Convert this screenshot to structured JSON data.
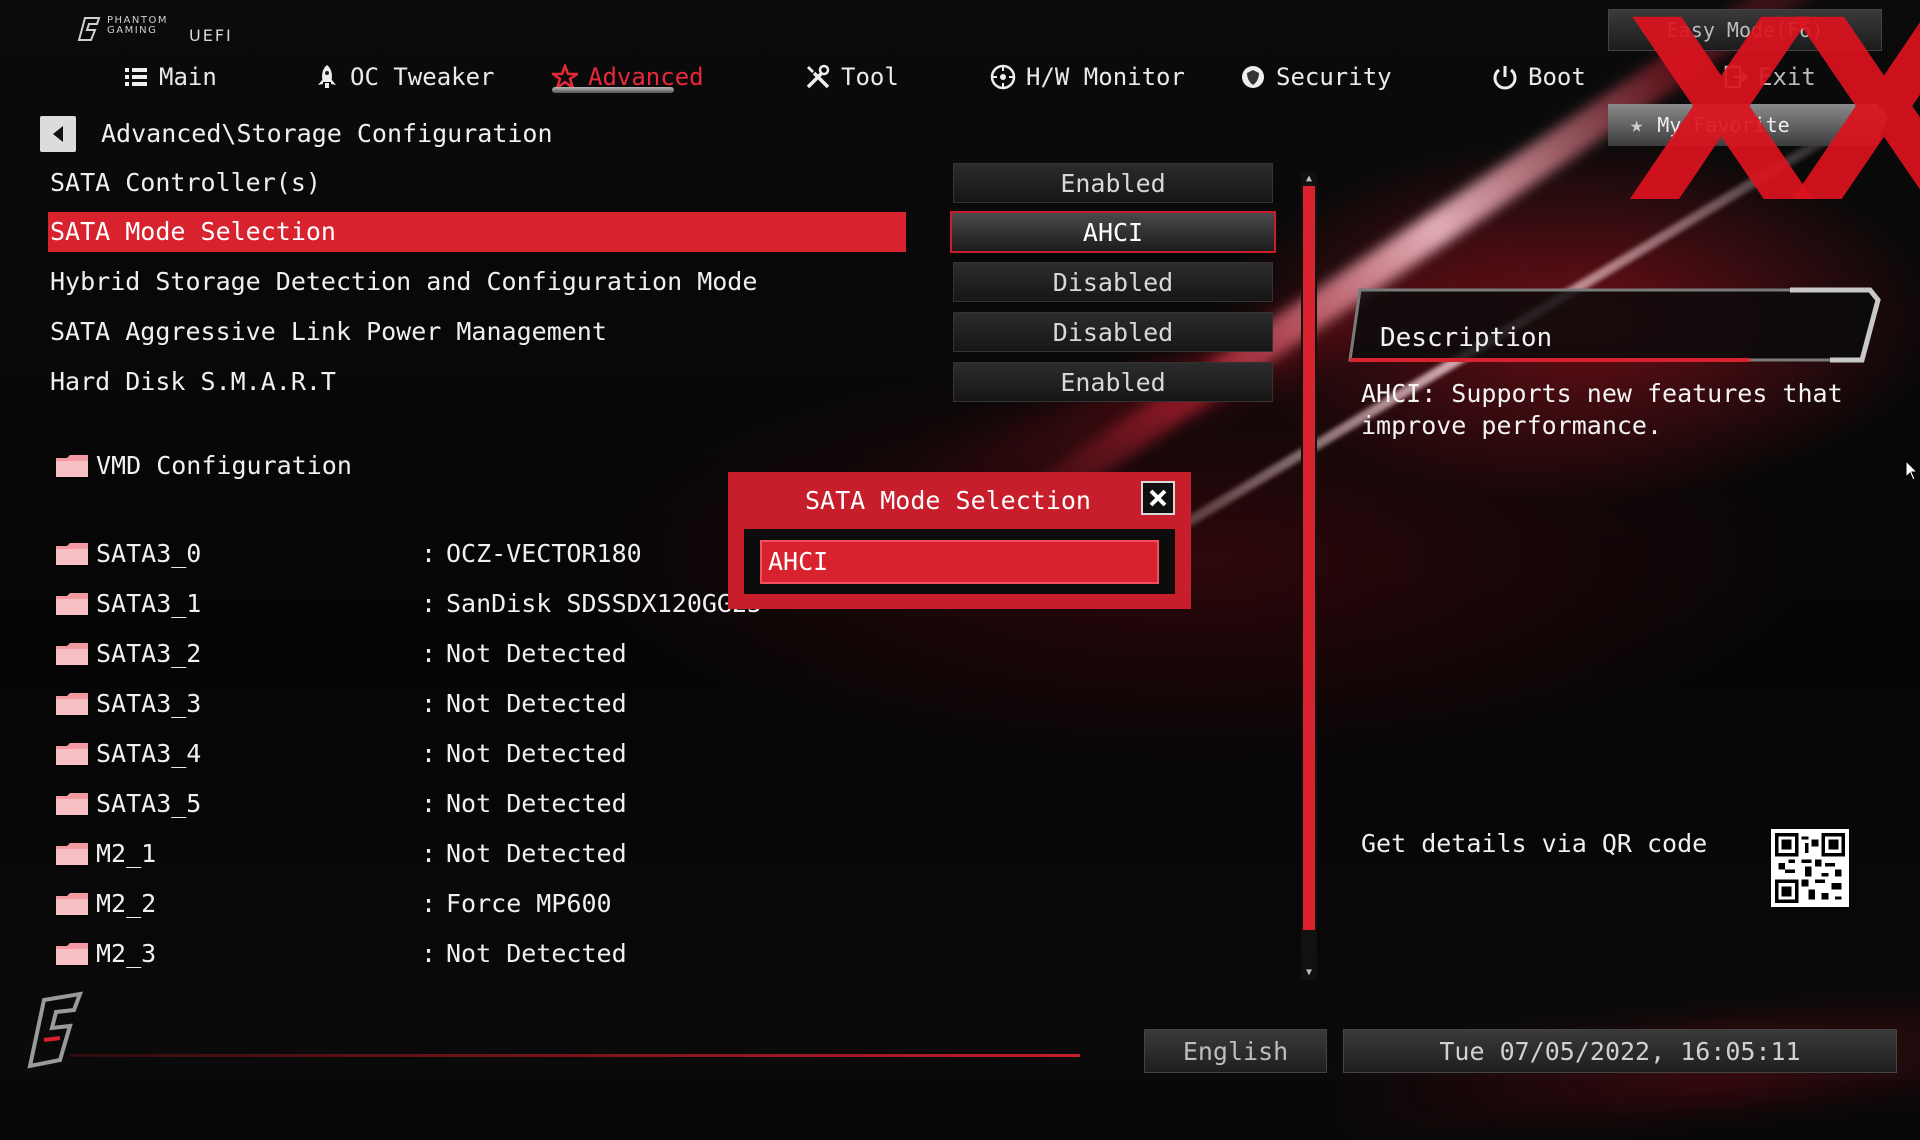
{
  "header": {
    "brand_top": "PHANTOM GAMING",
    "brand_uefi": "UEFI",
    "easy_mode": "Easy Mode(F6)",
    "my_favorite": "My Favorite",
    "watermark": "XX"
  },
  "nav": {
    "tabs": [
      {
        "label": "Main",
        "icon": "list-icon"
      },
      {
        "label": "OC Tweaker",
        "icon": "rocket-icon"
      },
      {
        "label": "Advanced",
        "icon": "star-icon",
        "active": true
      },
      {
        "label": "Tool",
        "icon": "tools-icon"
      },
      {
        "label": "H/W Monitor",
        "icon": "monitor-icon"
      },
      {
        "label": "Security",
        "icon": "shield-icon"
      },
      {
        "label": "Boot",
        "icon": "power-icon"
      },
      {
        "label": "Exit",
        "icon": "exit-icon"
      }
    ]
  },
  "breadcrumb": "Advanced\\Storage Configuration",
  "settings": [
    {
      "label": "SATA Controller(s)",
      "value": "Enabled"
    },
    {
      "label": "SATA Mode Selection",
      "value": "AHCI",
      "selected": true
    },
    {
      "label": "Hybrid Storage Detection and Configuration Mode",
      "value": "Disabled"
    },
    {
      "label": "SATA Aggressive Link Power Management",
      "value": "Disabled"
    },
    {
      "label": "Hard Disk S.M.A.R.T",
      "value": "Enabled"
    }
  ],
  "submenu": {
    "label": "VMD Configuration"
  },
  "devices": [
    {
      "name": "SATA3_0",
      "colon": ":",
      "value": "OCZ-VECTOR180"
    },
    {
      "name": "SATA3_1",
      "colon": ":",
      "value": "SanDisk SDSSDX120GG25"
    },
    {
      "name": "SATA3_2",
      "colon": ":",
      "value": "Not Detected"
    },
    {
      "name": "SATA3_3",
      "colon": ":",
      "value": "Not Detected"
    },
    {
      "name": "SATA3_4",
      "colon": ":",
      "value": "Not Detected"
    },
    {
      "name": "SATA3_5",
      "colon": ":",
      "value": "Not Detected"
    },
    {
      "name": "M2_1",
      "colon": ":",
      "value": "Not Detected"
    },
    {
      "name": "M2_2",
      "colon": ":",
      "value": "Force MP600"
    },
    {
      "name": "M2_3",
      "colon": ":",
      "value": "Not Detected"
    }
  ],
  "popup": {
    "title": "SATA Mode Selection",
    "option": "AHCI"
  },
  "description": {
    "title": "Description",
    "text": "AHCI: Supports new features that\nimprove performance.",
    "qr_label": "Get details via QR code"
  },
  "footer": {
    "language": "English",
    "datetime": "Tue 07/05/2022, 16:05:11"
  },
  "colors": {
    "accent": "#d8232f",
    "background": "#070707",
    "text": "#f0f0f0"
  }
}
